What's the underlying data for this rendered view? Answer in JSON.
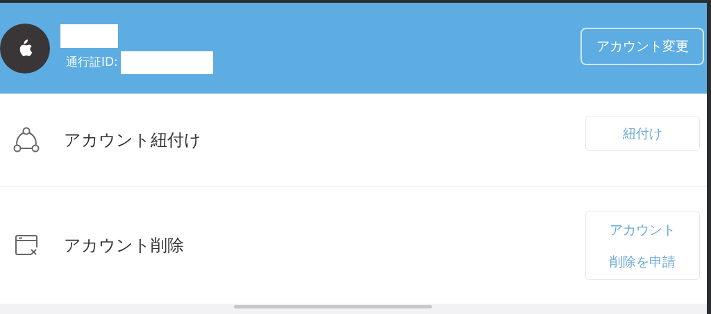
{
  "header": {
    "id_label": "通行証ID:",
    "change_button": "アカウント変更"
  },
  "rows": [
    {
      "kind": "link",
      "label": "アカウント紐付け",
      "button": "紐付け"
    },
    {
      "kind": "delete",
      "label": "アカウント削除",
      "button": "アカウント削除を申請"
    }
  ]
}
